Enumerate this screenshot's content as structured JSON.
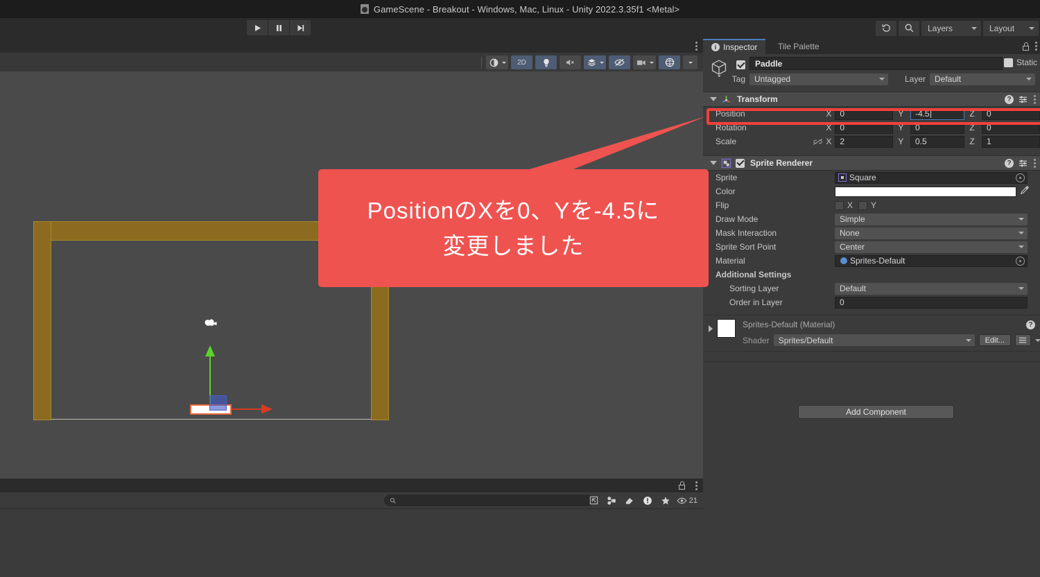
{
  "window": {
    "title": "GameScene - Breakout - Windows, Mac, Linux - Unity 2022.3.35f1 <Metal>",
    "doc_icon": "unity-scene-icon"
  },
  "toolbar": {
    "play_label": "play-button",
    "pause_label": "pause-button",
    "step_label": "step-button",
    "history_icon": "undo-history-icon",
    "search_icon": "search-icon",
    "layers": "Layers",
    "layout": "Layout"
  },
  "scene_view": {
    "toolbar": {
      "shading_icon": "shading-mode-icon",
      "two_d": "2D",
      "lighting_icon": "lighting-icon",
      "audio_icon": "audio-mute-icon",
      "fx_icon": "effects-icon",
      "hidden_icon": "hidden-objects-icon",
      "camera_icon": "scene-camera-icon",
      "gizmos_icon": "gizmos-icon"
    },
    "objects": {
      "walls": "wall-brick",
      "paddle": "paddle-sprite",
      "camera_gizmo": "main-camera-gizmo",
      "move_gizmo": "move-tool-gizmo"
    }
  },
  "console": {
    "search_placeholder": "",
    "search_value": "",
    "icons": [
      "console-collapse-icon",
      "console-connect-icon",
      "console-clear-icon",
      "console-error-icon",
      "console-favorite-icon",
      "eye-icon"
    ],
    "visible_count": "21",
    "lock_icon": "lock-icon",
    "menu_icon": "kebab-menu-icon"
  },
  "inspector": {
    "tabs": [
      {
        "label": "Inspector",
        "icon": "info-icon",
        "active": true
      },
      {
        "label": "Tile Palette",
        "icon": "tile-palette-icon",
        "active": false
      }
    ],
    "lock_icon": "lock-icon",
    "menu_icon": "kebab-menu-icon",
    "object": {
      "icon": "gameobject-cube-icon",
      "enabled": true,
      "name": "Paddle",
      "static_label": "Static",
      "static_checked": false,
      "tag_label": "Tag",
      "tag_value": "Untagged",
      "layer_label": "Layer",
      "layer_value": "Default"
    },
    "transform": {
      "title": "Transform",
      "icon": "transform-axis-icon",
      "help_icon": "help-icon",
      "preset_icon": "preset-icon",
      "menu_icon": "kebab-menu-icon",
      "rows": [
        {
          "label": "Position",
          "x": "0",
          "y": "-4.5",
          "z": "0",
          "highlighted": true,
          "focused_axis": "Y"
        },
        {
          "label": "Rotation",
          "x": "0",
          "y": "0",
          "z": "0",
          "highlighted": false
        },
        {
          "label": "Scale",
          "x": "2",
          "y": "0.5",
          "z": "1",
          "highlighted": false,
          "link_icon": "constrain-proportions-off-icon"
        }
      ],
      "axis_labels": {
        "x": "X",
        "y": "Y",
        "z": "Z"
      }
    },
    "sprite_renderer": {
      "title": "Sprite Renderer",
      "icon": "sprite-renderer-icon",
      "enabled": true,
      "help_icon": "help-icon",
      "preset_icon": "preset-icon",
      "menu_icon": "kebab-menu-icon",
      "fields": {
        "sprite_label": "Sprite",
        "sprite_value": "Square",
        "color_label": "Color",
        "color_value": "#FFFFFF",
        "flip_label": "Flip",
        "flip_x_label": "X",
        "flip_y_label": "Y",
        "flip_x_checked": false,
        "flip_y_checked": false,
        "draw_mode_label": "Draw Mode",
        "draw_mode_value": "Simple",
        "mask_interaction_label": "Mask Interaction",
        "mask_interaction_value": "None",
        "sprite_sort_point_label": "Sprite Sort Point",
        "sprite_sort_point_value": "Center",
        "material_label": "Material",
        "material_value": "Sprites-Default",
        "additional_settings_label": "Additional Settings",
        "sorting_layer_label": "Sorting Layer",
        "sorting_layer_value": "Default",
        "order_in_layer_label": "Order in Layer",
        "order_in_layer_value": "0"
      }
    },
    "material_block": {
      "name": "Sprites-Default (Material)",
      "shader_label": "Shader",
      "shader_value": "Sprites/Default",
      "edit_button": "Edit...",
      "help_icon": "help-icon",
      "expand_icon": "expand-arrow-icon",
      "render_queue_icon": "render-queue-icon"
    },
    "add_component": "Add Component"
  },
  "annotation": {
    "text": "PositionのXを0、Yを-4.5に\n変更しました",
    "color": "#ef5350",
    "highlight_color": "#f2403a",
    "target": "transform-position-row"
  }
}
